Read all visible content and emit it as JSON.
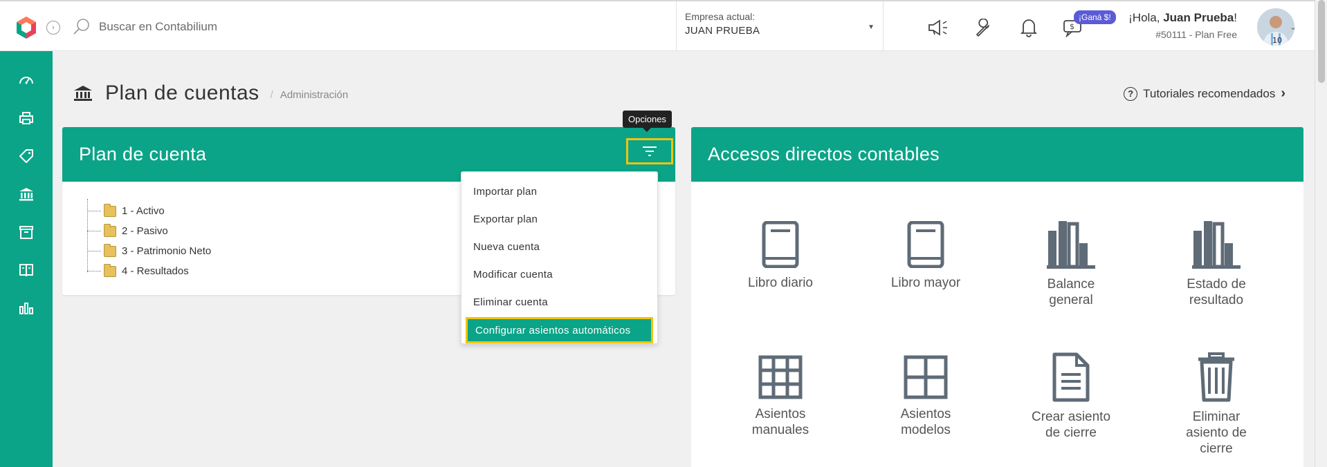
{
  "topbar": {
    "collapse_icon": "chevron-right-circle-icon",
    "search_placeholder": "Buscar en Contabilium",
    "company_label": "Empresa actual:",
    "company_value": "JUAN PRUEBA",
    "promo_badge": "¡Ganá $!",
    "greeting_prefix": "¡Hola, ",
    "user_name": "Juan Prueba",
    "greeting_suffix": "!",
    "plan_info": "#50111 - Plan Free"
  },
  "sidebar": {
    "items": [
      "dashboard-icon",
      "printer-icon",
      "tag-icon",
      "bank-icon",
      "box-icon",
      "book-icon",
      "bar-chart-icon"
    ]
  },
  "page": {
    "title": "Plan de cuentas",
    "breadcrumb_sep": "/",
    "breadcrumb": "Administración",
    "tutorials": "Tutoriales recomendados"
  },
  "left_card": {
    "title": "Plan de cuenta",
    "tooltip": "Opciones",
    "tree": [
      "1 - Activo",
      "2 - Pasivo",
      "3 - Patrimonio Neto",
      "4 - Resultados"
    ]
  },
  "options_menu": {
    "items": [
      "Importar plan",
      "Exportar plan",
      "Nueva cuenta",
      "Modificar cuenta",
      "Eliminar cuenta",
      "Configurar asientos automáticos"
    ]
  },
  "right_card": {
    "title": "Accesos directos contables",
    "shortcuts": [
      {
        "label_1": "Libro diario",
        "label_2": "",
        "label_3": ""
      },
      {
        "label_1": "Libro mayor",
        "label_2": "",
        "label_3": ""
      },
      {
        "label_1": "Balance",
        "label_2": "general",
        "label_3": ""
      },
      {
        "label_1": "Estado de",
        "label_2": "resultado",
        "label_3": ""
      },
      {
        "label_1": "Asientos",
        "label_2": "manuales",
        "label_3": ""
      },
      {
        "label_1": "Asientos",
        "label_2": "modelos",
        "label_3": ""
      },
      {
        "label_1": "Crear asiento",
        "label_2": "de cierre",
        "label_3": ""
      },
      {
        "label_1": "Eliminar",
        "label_2": "asiento de",
        "label_3": "cierre"
      }
    ]
  },
  "colors": {
    "brand": "#0ba488",
    "highlight": "#f1c40f",
    "icon_gray": "#5f6b77",
    "promo": "#5b5bd6"
  }
}
